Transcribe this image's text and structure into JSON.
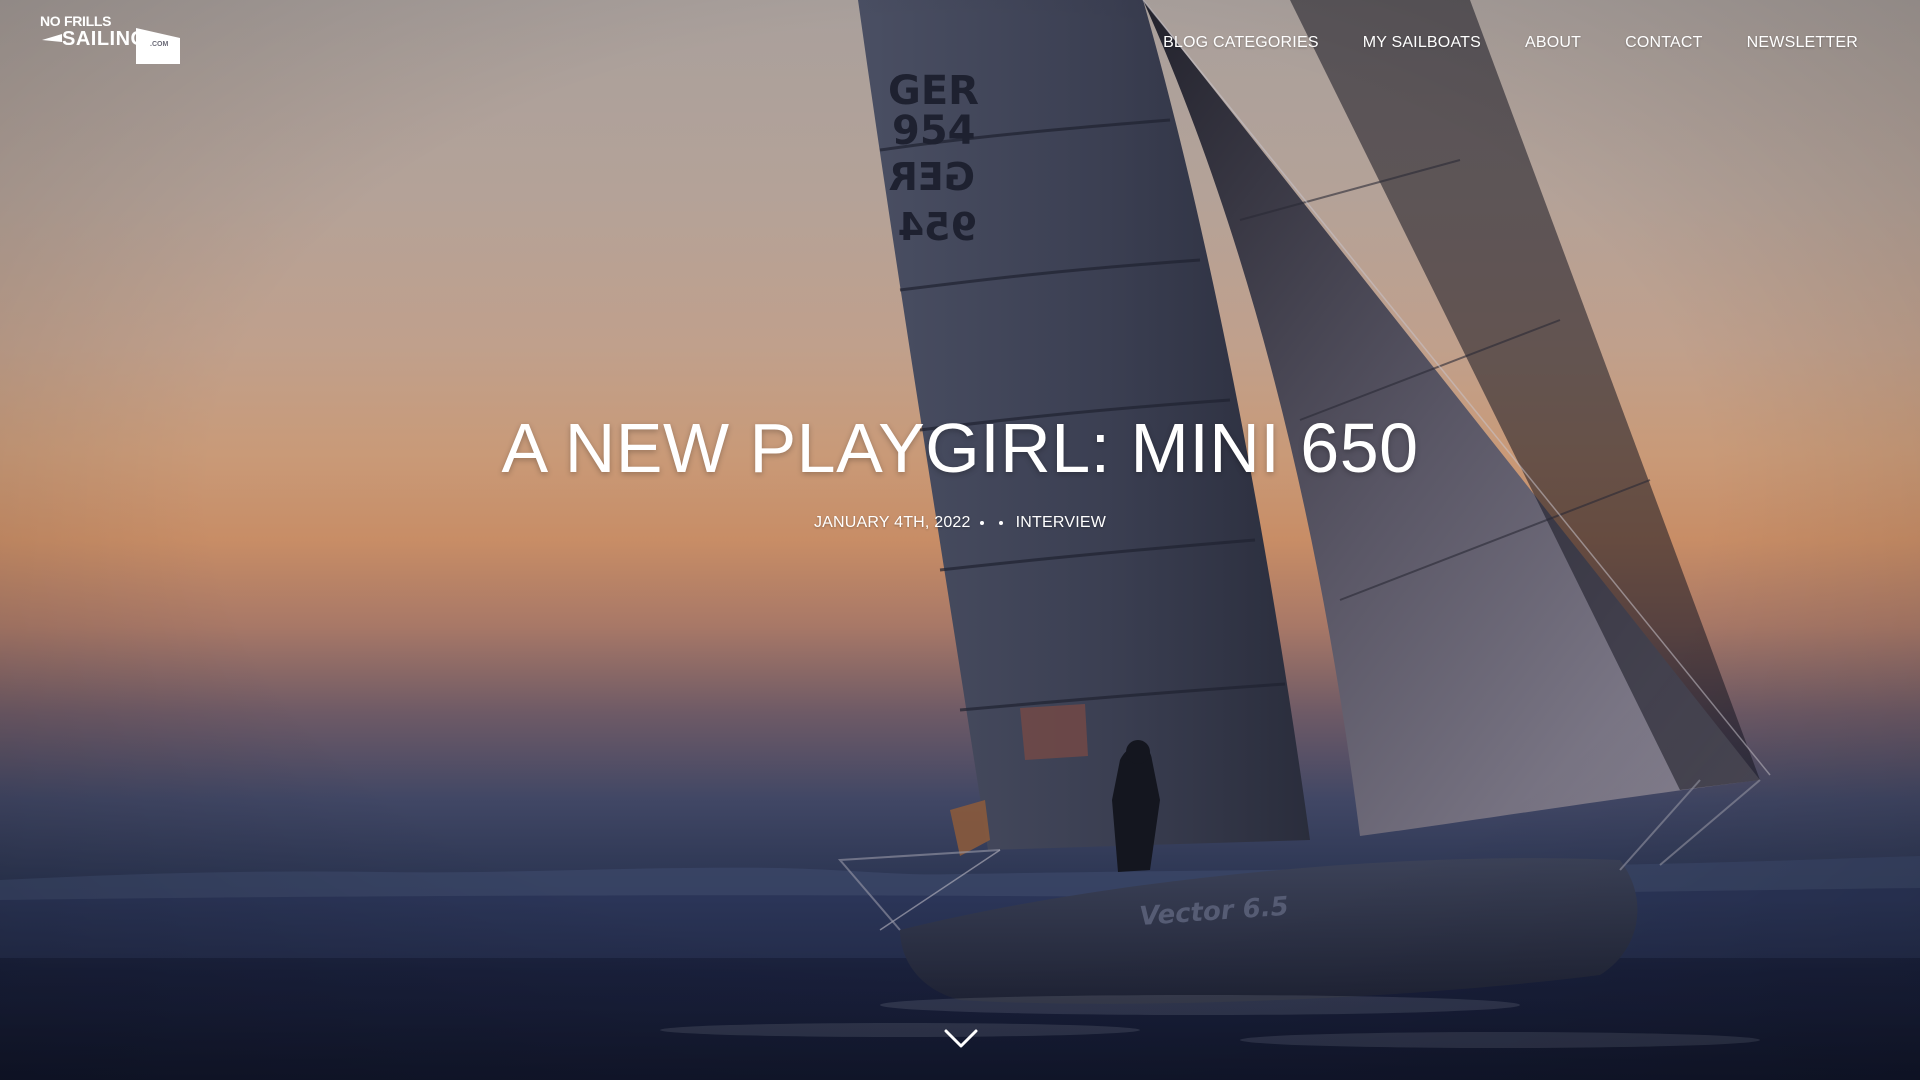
{
  "site": {
    "logo_line1": "NO FRILLS",
    "logo_line2": "SAILING",
    "logo_suffix": ".COM"
  },
  "nav": {
    "items": [
      {
        "label": "BLOG CATEGORIES"
      },
      {
        "label": "MY SAILBOATS"
      },
      {
        "label": "ABOUT"
      },
      {
        "label": "CONTACT"
      },
      {
        "label": "NEWSLETTER"
      }
    ]
  },
  "post": {
    "title": "A NEW PLAYGIRL: MINI 650",
    "date": "JANUARY 4TH, 2022",
    "category": "INTERVIEW"
  },
  "hero_image": {
    "sail_number_1": "GER",
    "sail_number_2": "954",
    "hull_text": "Vector 6.5"
  },
  "icons": {
    "scroll": "chevron-down-icon",
    "separator": "dot-separator"
  }
}
